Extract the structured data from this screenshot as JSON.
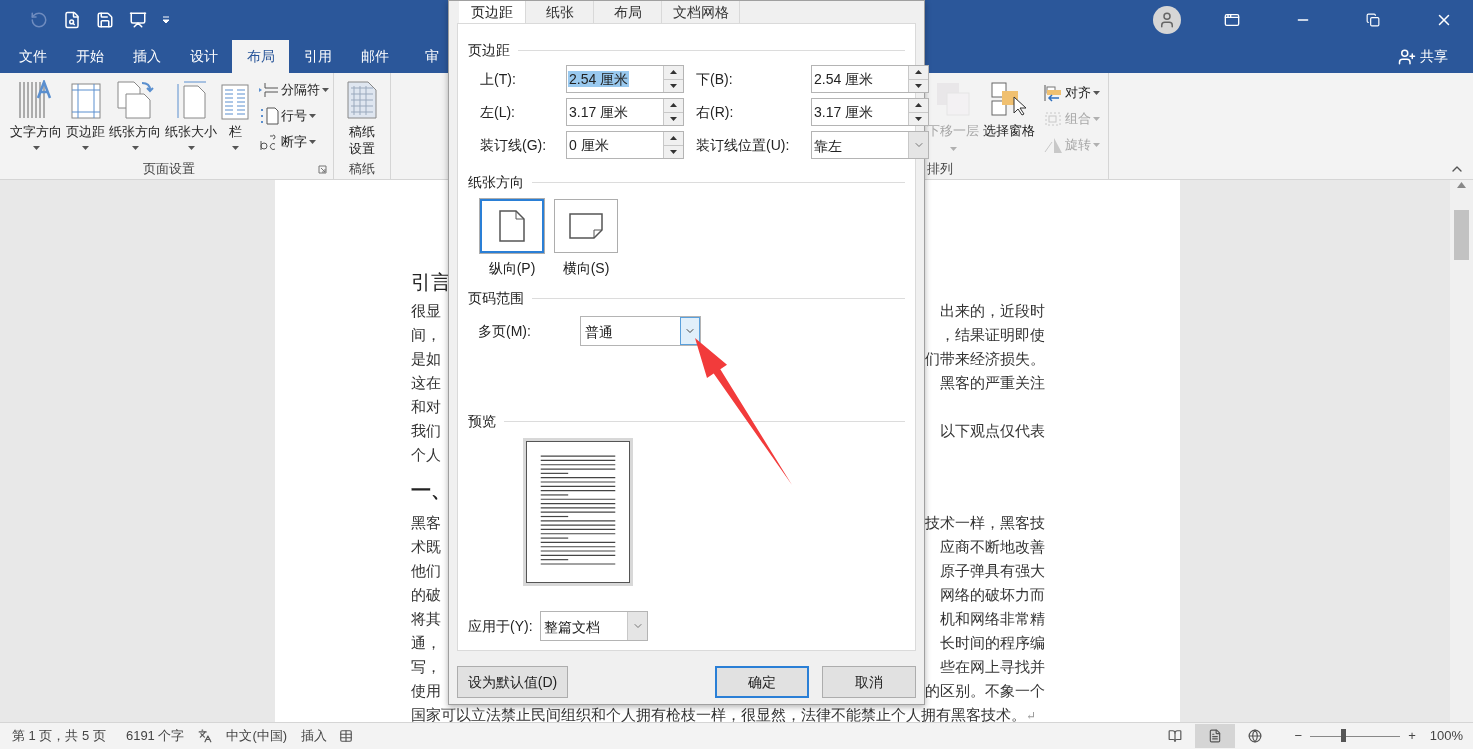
{
  "quick_access": {
    "undo_disabled": true
  },
  "tabs": [
    {
      "label": "文件",
      "selected": false
    },
    {
      "label": "开始",
      "selected": false
    },
    {
      "label": "插入",
      "selected": false
    },
    {
      "label": "设计",
      "selected": false
    },
    {
      "label": "布局",
      "selected": true
    },
    {
      "label": "引用",
      "selected": false
    },
    {
      "label": "邮件",
      "selected": false
    },
    {
      "label": "审",
      "selected": false
    }
  ],
  "share": "共享",
  "ribbon": {
    "left_groups": [
      {
        "label": "页面设置",
        "big": [
          {
            "label": "文字方向",
            "dropdown": true
          },
          {
            "label": "页边距",
            "dropdown": true
          },
          {
            "label": "纸张方向",
            "dropdown": true
          },
          {
            "label": "纸张大小",
            "dropdown": true
          },
          {
            "label": "栏",
            "dropdown": true
          }
        ],
        "small": [
          {
            "label": "分隔符"
          },
          {
            "label": "行号"
          },
          {
            "label": "断字"
          }
        ]
      },
      {
        "label": "稿纸",
        "big": [
          {
            "label": "稿纸设置",
            "dropdown": false
          }
        ]
      }
    ],
    "right_group": {
      "label": "排列",
      "big": [
        {
          "label": "下移一层",
          "dropdown": true,
          "disabled": true
        },
        {
          "label": "选择窗格",
          "dropdown": false,
          "disabled": false
        }
      ],
      "small": [
        {
          "label": "对齐",
          "disabled": false
        },
        {
          "label": "组合",
          "disabled": true
        },
        {
          "label": "旋转",
          "disabled": true
        }
      ]
    }
  },
  "document": {
    "heading_1": "引言",
    "paragraph_1": [
      {
        "left": "很显",
        "right": "出来的，近段时"
      },
      {
        "left": "间，",
        "right": "，结果证明即使"
      },
      {
        "left": "是如",
        "right": "们带来经济损失。"
      },
      {
        "left": "这在",
        "right": "黑客的严重关注"
      },
      {
        "left": "和对"
      },
      {
        "left": "我们",
        "right": "以下观点仅代表"
      },
      {
        "left": "个人"
      }
    ],
    "heading_2": "一、",
    "paragraph_2": [
      {
        "left": "黑客",
        "right": "技术一样，黑客技"
      },
      {
        "left": "术既",
        "right": "应商不断地改善"
      },
      {
        "left": "他们",
        "right": "原子弹具有强大"
      },
      {
        "left": "的破",
        "right": "网络的破坏力而"
      },
      {
        "left": "将其",
        "right": "机和网络非常精"
      },
      {
        "left": "通，",
        "right": "长时间的程序编"
      },
      {
        "left": "写，",
        "right": "些在网上寻找并"
      },
      {
        "left": "使用",
        "right": "的区别。不象一个"
      },
      {
        "left": "国家可以立法禁止民间组织和个人拥有枪枝一样，很显然，法律不能禁止个人拥有黑客技术。"
      }
    ],
    "end_mark": "↵"
  },
  "dialog": {
    "tabs": [
      {
        "label": "页边距",
        "selected": true
      },
      {
        "label": "纸张",
        "selected": false
      },
      {
        "label": "布局",
        "selected": false
      },
      {
        "label": "文档网格",
        "selected": false
      }
    ],
    "margins_title": "页边距",
    "margin_fields": [
      {
        "label": "上(T):",
        "value": "2.54 厘米",
        "kind": "spin",
        "text_selected": true
      },
      {
        "label": "下(B):",
        "value": "2.54 厘米",
        "kind": "spin",
        "text_selected": false
      },
      {
        "label": "左(L):",
        "value": "3.17 厘米",
        "kind": "spin",
        "text_selected": false
      },
      {
        "label": "右(R):",
        "value": "3.17 厘米",
        "kind": "spin",
        "text_selected": false
      },
      {
        "label": "装订线(G):",
        "value": "0 厘米",
        "kind": "spin",
        "text_selected": false
      },
      {
        "label": "装订线位置(U):",
        "value": "靠左",
        "kind": "dropdown",
        "text_selected": false
      }
    ],
    "orientation_title": "纸张方向",
    "orientations": [
      {
        "label": "纵向(P)",
        "kind": "portrait",
        "selected": true
      },
      {
        "label": "横向(S)",
        "kind": "landscape",
        "selected": false
      }
    ],
    "pages_title": "页码范围",
    "pages_label": "多页(M):",
    "pages_value": "普通",
    "preview_title": "预览",
    "apply_label": "应用于(Y):",
    "apply_value": "整篇文档",
    "buttons": [
      {
        "label": "设为默认值(D)",
        "kind": "left",
        "default": false
      },
      {
        "label": "确定",
        "kind": "right",
        "default": true
      },
      {
        "label": "取消",
        "kind": "right",
        "default": false
      }
    ]
  },
  "status_bar": {
    "page": "第 1 页，共 5 页",
    "words": "6191 个字",
    "language": "中文(中国)",
    "mode": "插入",
    "views": [
      {
        "selected": false
      },
      {
        "selected": true
      },
      {
        "selected": false
      }
    ],
    "zoom_minus": "−",
    "zoom_plus": "+",
    "zoom_slider": {
      "level": 0.37
    },
    "zoom": "100%"
  }
}
